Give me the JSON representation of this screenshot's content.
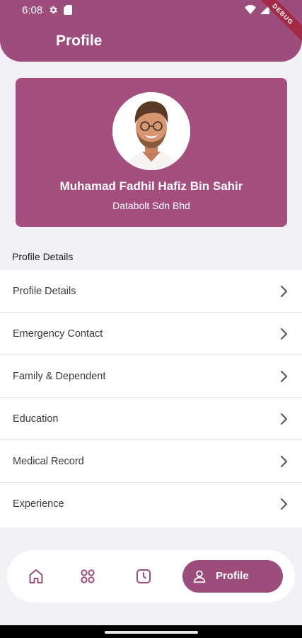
{
  "status_bar": {
    "time": "6:08",
    "debug_label": "DEBUG"
  },
  "app_bar": {
    "title": "Profile"
  },
  "profile": {
    "name": "Muhamad Fadhil Hafiz Bin Sahir",
    "company": "Databolt Sdn Bhd"
  },
  "section": {
    "title": "Profile Details"
  },
  "menu": {
    "items": [
      {
        "label": "Profile Details"
      },
      {
        "label": "Emergency Contact"
      },
      {
        "label": "Family & Dependent"
      },
      {
        "label": "Education"
      },
      {
        "label": "Medical Record"
      },
      {
        "label": "Experience"
      }
    ]
  },
  "bottom_nav": {
    "items": [
      {
        "icon": "home-icon"
      },
      {
        "icon": "apps-grid-icon"
      },
      {
        "icon": "clock-icon"
      },
      {
        "icon": "user-icon",
        "label": "Profile",
        "active": true
      }
    ]
  },
  "colors": {
    "primary": "#9d4d7c",
    "card": "#a34e7d",
    "background": "#f1f0f5",
    "debug_ribbon": "#a32a45"
  }
}
